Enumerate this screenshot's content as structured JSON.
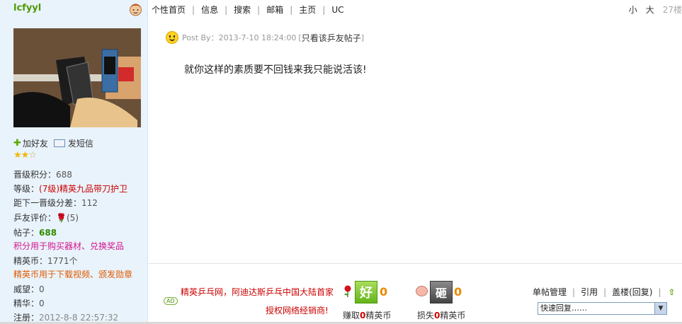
{
  "user": {
    "name": "lcfyyl",
    "add_friend": "加好友",
    "send_message": "发短信"
  },
  "nav": {
    "items": [
      "个性首页",
      "信息",
      "搜索",
      "邮箱",
      "主页",
      "UC"
    ],
    "font_small": "小",
    "font_large": "大",
    "floor": "27楼"
  },
  "stats": {
    "level_points": {
      "label": "晋级积分：",
      "value": "688"
    },
    "rank": {
      "label": "等级：",
      "value": "(7级)精英九品带刀护卫"
    },
    "next_diff": {
      "label": "距下一晋级分差：",
      "value": "112"
    },
    "rating": {
      "label": "乒友评价：",
      "value": "(5)"
    },
    "posts": {
      "label": "帖子：",
      "value": "688"
    },
    "points_note": "积分用于购买器材、兑换奖品",
    "coins": {
      "label": "精英币：",
      "value": "1771个"
    },
    "coins_note": "精英币用于下载视频、颁发勋章",
    "prestige": {
      "label": "威望：",
      "value": "0"
    },
    "essence": {
      "label": "精华：",
      "value": "0"
    },
    "registered": {
      "label": "注册：",
      "value": "2012-8-8 22:57:32"
    }
  },
  "post": {
    "by_label": "Post By：",
    "timestamp": "2013-7-10 18:24:00",
    "only_link": "只看该乒友帖子",
    "content": "就你这样的素质要不回钱来我只能说活该!"
  },
  "ad": {
    "badge": "AD",
    "line1": "精英乒乓网，阿迪达斯乒乓中国大陆首家",
    "line2": "授权网络经销商!"
  },
  "votes": {
    "good_label": "好",
    "good_count": "0",
    "earn_prefix": "赚取",
    "earn_value": "0",
    "earn_suffix": "精英币",
    "bad_label": "砸",
    "bad_count": "0",
    "lose_prefix": "损失",
    "lose_value": "0",
    "lose_suffix": "精英币"
  },
  "post_actions": [
    "单帖管理",
    "引用",
    "盖楼(回复)"
  ],
  "quick_reply": {
    "selected": "快速回复……"
  },
  "colors": {
    "username": "#4e9a06",
    "sidebar_bg": "#e9f3fb",
    "accent_red": "#cc0000",
    "pink": "#d4148c",
    "orange": "#e05a00"
  }
}
